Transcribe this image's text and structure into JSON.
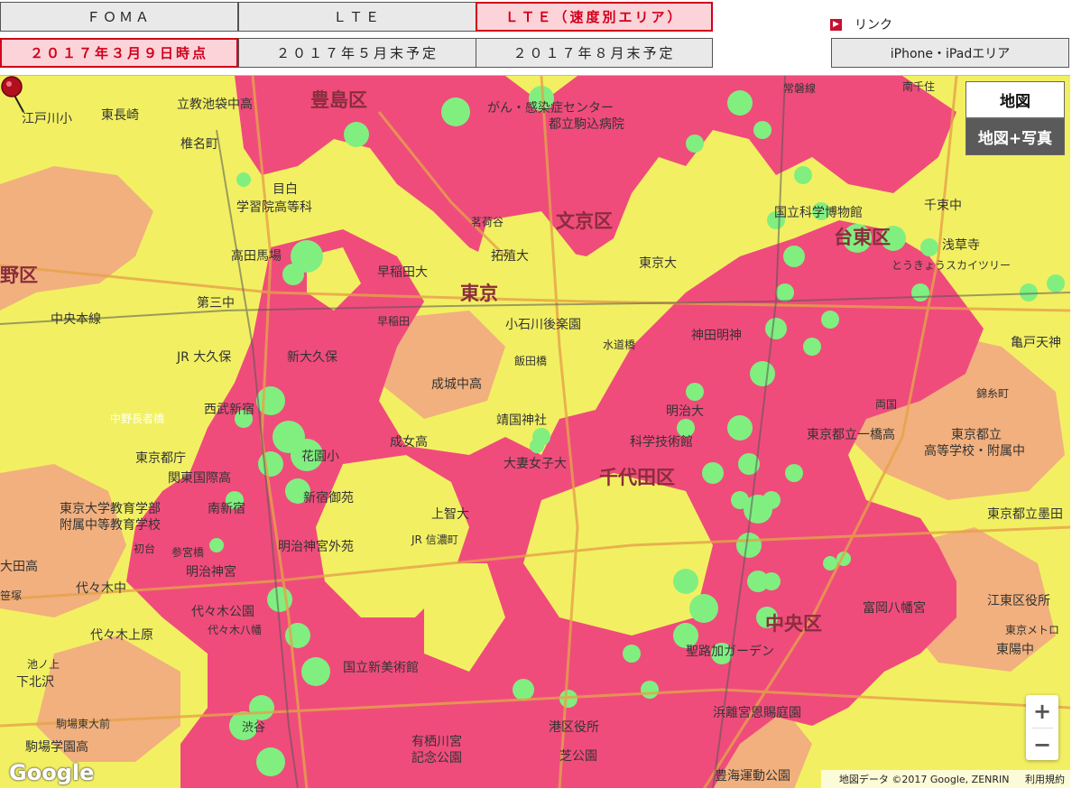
{
  "tabs_row1": [
    {
      "label": "ＦＯＭＡ",
      "active": false
    },
    {
      "label": "ＬＴＥ",
      "active": false
    },
    {
      "label": "ＬＴＥ（速度別エリア）",
      "active": true
    }
  ],
  "tabs_row2": [
    {
      "label": "２０１７年３月９日時点",
      "active": true
    },
    {
      "label": "２０１７年５月末予定",
      "active": false
    },
    {
      "label": "２０１７年８月末予定",
      "active": false
    }
  ],
  "links": {
    "heading": "リンク",
    "iphone_button": "iPhone・iPadエリア"
  },
  "map_type": {
    "map": "地図",
    "satellite": "地図+写真"
  },
  "zoom": {
    "in": "+",
    "out": "−"
  },
  "footer": {
    "logo": "Google",
    "map_data": "地図データ ©2017 Google, ZENRIN",
    "terms": "利用規約"
  },
  "colors": {
    "coverage_top": "#ef4c7c",
    "coverage_high": "#f2b07e",
    "coverage_mid": "#f2f062",
    "coverage_fast_spot": "#80ef80",
    "accent": "#d0001c"
  },
  "map_labels": {
    "wards": [
      "豊島区",
      "文京区",
      "台東区",
      "千代田区",
      "中央区",
      "東京",
      "野区"
    ],
    "places": [
      "立教池袋中高",
      "江戸川小",
      "東長崎",
      "椎名町",
      "学習院高等科",
      "目白",
      "高田馬場",
      "第三中",
      "中央本線",
      "JR 大久保",
      "西武新宿",
      "新大久保",
      "中野長者橋",
      "東京都庁",
      "関東国際高",
      "東京大学教育学部附属中等教育学校",
      "南新宿",
      "初台",
      "参宮橋",
      "明治神宮",
      "代々木公園",
      "代々木八幡",
      "代々木上原",
      "代々木中",
      "大田高",
      "笹塚",
      "池ノ上",
      "下北沢",
      "駒場東大前",
      "駒場学園高",
      "渋谷",
      "国立新美術館",
      "新宿御苑",
      "花園小",
      "明治神宮外苑",
      "JR 信濃町",
      "成城中高",
      "成女高",
      "上智大",
      "靖国神社",
      "大妻女子大",
      "千代田区",
      "科学技術館",
      "明治大",
      "神田明神",
      "水道橋",
      "飯田橋",
      "小石川後楽園",
      "拓殖大",
      "早稲田大",
      "早稲田",
      "茗荷谷",
      "東京大",
      "上野",
      "国立科学博物館",
      "浅草寺",
      "とうきょうスカイツリー",
      "東京都立一橋高",
      "東京都立高等学校・附属中",
      "両国",
      "錦糸町",
      "亀戸天神",
      "江東区役所",
      "東陽中",
      "富岡八幡宮",
      "聖路加ガーデン",
      "浜離宮恩賜庭園",
      "豊海運動公園",
      "芝公園",
      "港区役所",
      "有栖川宮記念公園",
      "がん・感染症センター都立駒込病院",
      "常磐線",
      "南千住",
      "千束中",
      "東京都立墨田",
      "東京メトロ"
    ]
  }
}
